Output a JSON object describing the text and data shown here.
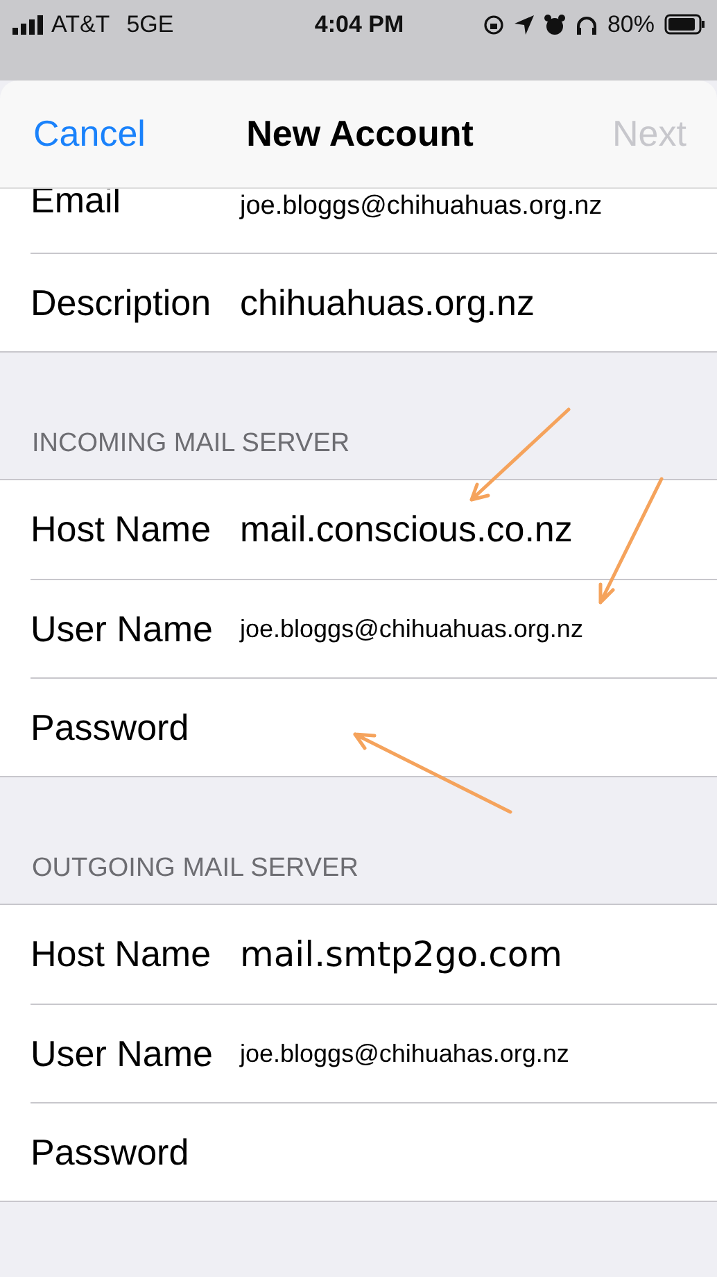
{
  "status_bar": {
    "carrier": "AT&T",
    "network": "5GE",
    "time": "4:04 PM",
    "battery_percent": "80%"
  },
  "sheet": {
    "cancel": "Cancel",
    "title": "New Account",
    "next": {
      "label": "Next",
      "disabled": true
    }
  },
  "groups": [
    {
      "rows": [
        {
          "label": "Email",
          "value": "joe.bloggs@chihuahuas.org.nz"
        },
        {
          "label": "Description",
          "value": "chihuahuas.org.nz"
        }
      ]
    },
    {
      "header": "INCOMING MAIL SERVER",
      "rows": [
        {
          "label": "Host Name",
          "value": "mail.conscious.co.nz"
        },
        {
          "label": "User Name",
          "value": "joe.bloggs@chihuahuas.org.nz"
        },
        {
          "label": "Password",
          "value": null
        }
      ]
    },
    {
      "header": "OUTGOING MAIL SERVER",
      "rows": [
        {
          "label": "Host Name",
          "value": "mail.smtp2go.com"
        },
        {
          "label": "User Name",
          "value": "joe.bloggs@chihuahas.org.nz"
        },
        {
          "label": "Password",
          "value": null
        }
      ]
    }
  ]
}
